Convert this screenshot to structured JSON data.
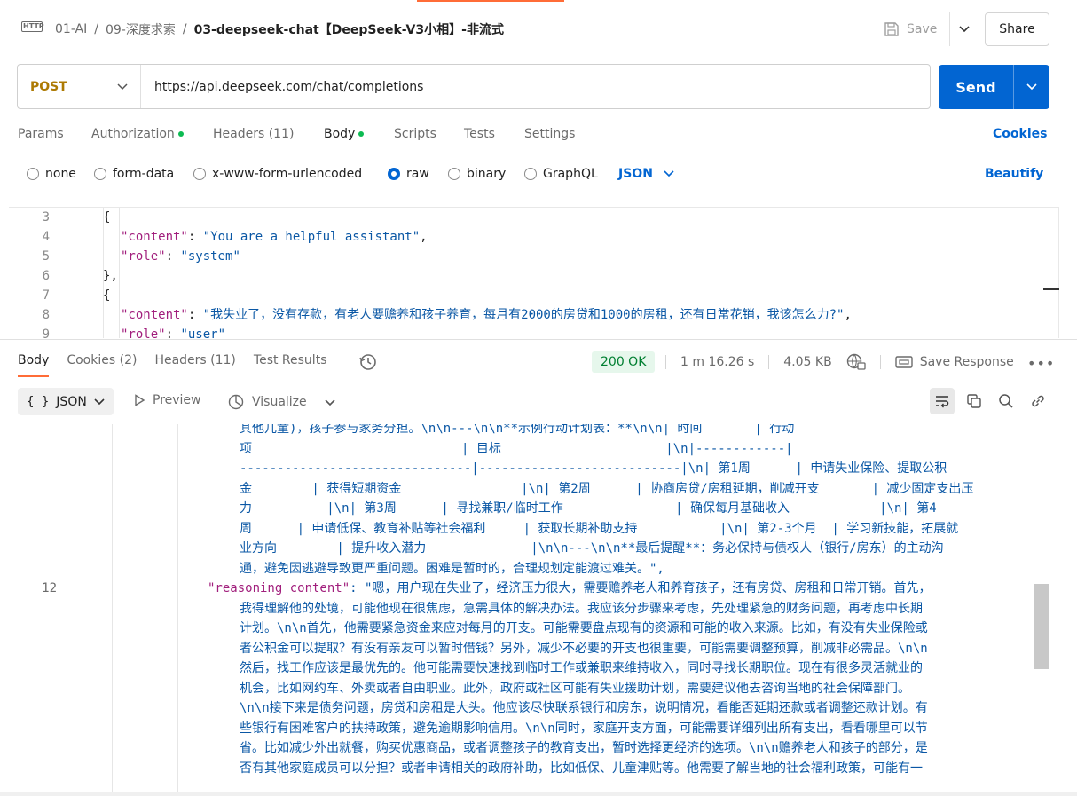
{
  "header": {
    "breadcrumb": [
      "01-AI",
      "/",
      "09-深度求索",
      "/"
    ],
    "request_name": "03-deepseek-chat【DeepSeek-V3小相】-非流式",
    "save_label": "Save",
    "share_label": "Share"
  },
  "request": {
    "method": "POST",
    "url": "https://api.deepseek.com/chat/completions",
    "send_label": "Send"
  },
  "req_tabs": [
    "Params",
    "Authorization",
    "Headers (11)",
    "Body",
    "Scripts",
    "Tests",
    "Settings"
  ],
  "cookies_label": "Cookies",
  "body_types": [
    "none",
    "form-data",
    "x-www-form-urlencoded",
    "raw",
    "binary",
    "GraphQL"
  ],
  "body_format": "JSON",
  "beautify_label": "Beautify",
  "editor": {
    "line_numbers": [
      "3",
      "4",
      "5",
      "6",
      "7",
      "8",
      "9"
    ],
    "lines": [
      "{",
      "\"content\"",
      "\"You are a helpful assistant\"",
      "\"role\"",
      "\"system\"",
      "},",
      "{",
      "\"content\"",
      "\"我失业了，没有存款，有老人要赡养和孩子养育，每月有2000的房贷和1000的房租，还有日常花销，我该怎么力?\"",
      "\"role\"",
      "\"user\""
    ]
  },
  "response": {
    "tabs": [
      "Body",
      "Cookies (2)",
      "Headers (11)",
      "Test Results"
    ],
    "status": "200 OK",
    "time": "1 m 16.26 s",
    "size": "4.05 KB",
    "save_response_label": "Save Response",
    "format": "JSON",
    "preview_label": "Preview",
    "visualize_label": "Visualize",
    "line_number": "12",
    "key": "\"reasoning_content\"",
    "content_lines": [
      "其他儿童)，孩子参与家务分担。\\n\\n---\\n\\n**示例行动计划表：**\\n\\n| 时间       | 行动",
      "项                            | 目标                      |\\n|------------|",
      "-------------------------------|---------------------------|\\n| 第1周      | 申请失业保险、提取公积",
      "金        | 获得短期资金                |\\n| 第2周      | 协商房贷/房租延期，削减开支       | 减少固定支出压",
      "力          |\\n| 第3周      | 寻找兼职/临时工作               | 确保每月基础收入            |\\n| 第4",
      "周      | 申请低保、教育补贴等社会福利     | 获取长期补助支持           |\\n| 第2-3个月  | 学习新技能，拓展就",
      "业方向        | 提升收入潜力              |\\n\\n---\\n\\n**最后提醒**：务必保持与债权人（银行/房东）的主动沟",
      "通，避免因逃避导致更严重问题。困难是暂时的，合理规划定能渡过难关。\","
    ],
    "reasoning_lines": [
      ": \"嗯，用户现在失业了，经济压力很大，需要赡养老人和养育孩子，还有房贷、房租和日常开销。首先，",
      "我得理解他的处境，可能他现在很焦虑，急需具体的解决办法。我应该分步骤来考虑，先处理紧急的财务问题，再考虑中长期",
      "计划。\\n\\n首先，他需要紧急资金来应对每月的开支。可能需要盘点现有的资源和可能的收入来源。比如，有没有失业保险或",
      "者公积金可以提取？有没有亲友可以暂时借钱？另外，减少不必要的开支也很重要，可能需要调整预算，削减非必需品。\\n\\n",
      "然后，找工作应该是最优先的。他可能需要快速找到临时工作或兼职来维持收入，同时寻找长期职位。现在有很多灵活就业的",
      "机会，比如网约车、外卖或者自由职业。此外，政府或社区可能有失业援助计划，需要建议他去咨询当地的社会保障部门。",
      "\\n\\n接下来是债务问题，房贷和房租是大头。他应该尽快联系银行和房东，说明情况，看能否延期还款或者调整还款计划。有",
      "些银行有困难客户的扶持政策，避免逾期影响信用。\\n\\n同时，家庭开支方面，可能需要详细列出所有支出，看看哪里可以节",
      "省。比如减少外出就餐，购买优惠商品，或者调整孩子的教育支出，暂时选择更经济的选项。\\n\\n赡养老人和孩子的部分，是",
      "否有其他家庭成员可以分担？或者申请相关的政府补助，比如低保、儿童津贴等。他需要了解当地的社会福利政策，可能有一"
    ]
  }
}
